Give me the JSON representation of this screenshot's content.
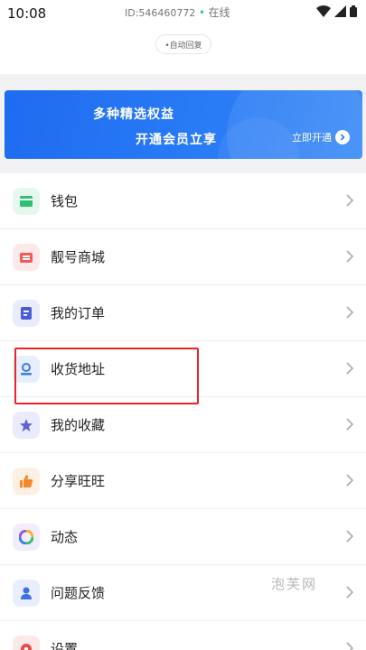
{
  "status_bar": {
    "time": "10:08",
    "account_id": "ID:546460772",
    "online": "在线",
    "online_dot": "•",
    "icons": [
      "wifi-icon",
      "signal-icon",
      "battery-icon"
    ]
  },
  "header": {
    "auto_reply": "•自动回复"
  },
  "banner": {
    "line1": "多种精选权益",
    "line2": "开通会员立享",
    "cta": "立即开通"
  },
  "menu": {
    "items": [
      {
        "label": "钱包",
        "icon": "wallet-icon",
        "color": "#2fbf71",
        "bg": "#e6f7ee"
      },
      {
        "label": "靓号商城",
        "icon": "shop-icon",
        "color": "#f05a5a",
        "bg": "#fde9e9"
      },
      {
        "label": "我的订单",
        "icon": "order-icon",
        "color": "#4a5bd8",
        "bg": "#e9ecfb"
      },
      {
        "label": "收货地址",
        "icon": "address-icon",
        "color": "#3c7bf0",
        "bg": "#e7effd"
      },
      {
        "label": "我的收藏",
        "icon": "star-icon",
        "color": "#5a63d6",
        "bg": "#eaebfb"
      },
      {
        "label": "分享旺旺",
        "icon": "thumb-up-icon",
        "color": "#f08a2a",
        "bg": "#fdf0e2"
      },
      {
        "label": "动态",
        "icon": "moments-icon",
        "color": "#8e5bd8",
        "bg": "#f3ecfb"
      },
      {
        "label": "问题反馈",
        "icon": "feedback-icon",
        "color": "#3d6fe6",
        "bg": "#e8eefc"
      },
      {
        "label": "设置",
        "icon": "settings-icon",
        "color": "#e84a4a",
        "bg": "#fde8e8"
      }
    ]
  },
  "watermark": "泡芙网",
  "colors": {
    "accent": "#1e6cf0",
    "highlight": "#e8232a"
  }
}
